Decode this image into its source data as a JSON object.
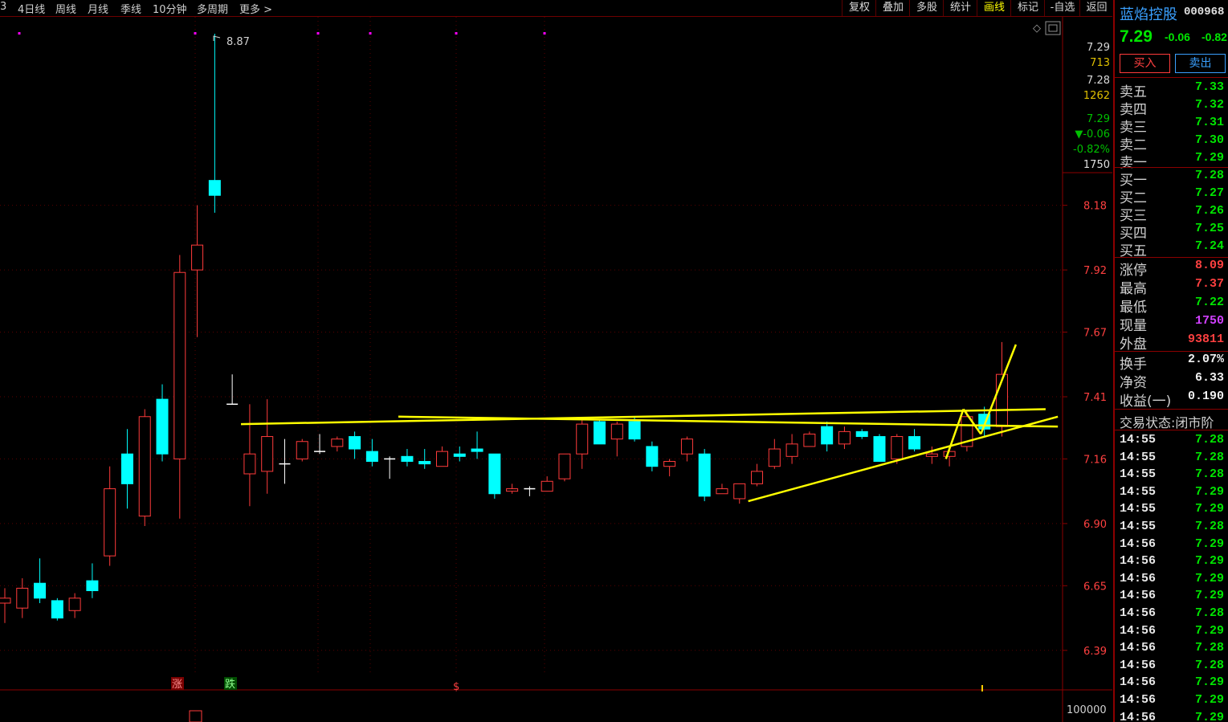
{
  "topbar": {
    "left_tabs": [
      "3",
      "4日线",
      "周线",
      "月线",
      "季线",
      "10分钟",
      "多周期",
      "更多 >"
    ],
    "right_tabs": [
      "复权",
      "叠加",
      "多股",
      "统计",
      "画线",
      "标记",
      "-自选",
      "返回"
    ],
    "active_right_tab": "画线"
  },
  "chart": {
    "peak_label": "8.87",
    "markers": [
      "涨",
      "跌",
      "$"
    ],
    "volume_axis_label": "100000",
    "price_ticks": [
      "8.18",
      "7.92",
      "7.67",
      "7.41",
      "7.16",
      "6.90",
      "6.65",
      "6.39"
    ],
    "info_panel": [
      "7.29",
      "713",
      "7.28",
      "1262",
      "7.29",
      "▼-0.06",
      "-0.82%",
      "1750"
    ],
    "colors": {
      "up": "#ff3b3b",
      "down": "#00ffff",
      "drawing": "#ffff00",
      "grid": "#5a0000"
    }
  },
  "chart_data": {
    "type": "candlestick",
    "ylim": [
      6.25,
      9.0
    ],
    "candles": [
      {
        "o": 6.58,
        "h": 6.64,
        "l": 6.5,
        "c": 6.6
      },
      {
        "o": 6.56,
        "h": 6.68,
        "l": 6.52,
        "c": 6.64
      },
      {
        "o": 6.66,
        "h": 6.76,
        "l": 6.58,
        "c": 6.6
      },
      {
        "o": 6.59,
        "h": 6.6,
        "l": 6.51,
        "c": 6.52
      },
      {
        "o": 6.55,
        "h": 6.62,
        "l": 6.52,
        "c": 6.6
      },
      {
        "o": 6.67,
        "h": 6.74,
        "l": 6.6,
        "c": 6.63
      },
      {
        "o": 6.77,
        "h": 7.13,
        "l": 6.73,
        "c": 7.04
      },
      {
        "o": 7.18,
        "h": 7.28,
        "l": 6.96,
        "c": 7.06
      },
      {
        "o": 6.93,
        "h": 7.36,
        "l": 6.89,
        "c": 7.33
      },
      {
        "o": 7.4,
        "h": 7.46,
        "l": 7.15,
        "c": 7.18
      },
      {
        "o": 7.16,
        "h": 7.98,
        "l": 6.92,
        "c": 7.91
      },
      {
        "o": 7.92,
        "h": 8.18,
        "l": 7.65,
        "c": 8.02
      },
      {
        "o": 8.28,
        "h": 8.87,
        "l": 8.15,
        "c": 8.22
      },
      {
        "o": 7.38,
        "h": 7.5,
        "l": 7.38,
        "c": 7.38
      },
      {
        "o": 7.1,
        "h": 7.38,
        "l": 6.97,
        "c": 7.18
      },
      {
        "o": 7.11,
        "h": 7.4,
        "l": 7.02,
        "c": 7.25
      },
      {
        "o": 7.14,
        "h": 7.24,
        "l": 7.06,
        "c": 7.14
      },
      {
        "o": 7.16,
        "h": 7.24,
        "l": 7.15,
        "c": 7.23
      },
      {
        "o": 7.19,
        "h": 7.26,
        "l": 7.18,
        "c": 7.19
      },
      {
        "o": 7.21,
        "h": 7.25,
        "l": 7.19,
        "c": 7.24
      },
      {
        "o": 7.25,
        "h": 7.27,
        "l": 7.16,
        "c": 7.2
      },
      {
        "o": 7.19,
        "h": 7.24,
        "l": 7.13,
        "c": 7.15
      },
      {
        "o": 7.16,
        "h": 7.17,
        "l": 7.08,
        "c": 7.16
      },
      {
        "o": 7.17,
        "h": 7.2,
        "l": 7.13,
        "c": 7.15
      },
      {
        "o": 7.15,
        "h": 7.2,
        "l": 7.12,
        "c": 7.14
      },
      {
        "o": 7.13,
        "h": 7.21,
        "l": 7.13,
        "c": 7.19
      },
      {
        "o": 7.18,
        "h": 7.21,
        "l": 7.15,
        "c": 7.17
      },
      {
        "o": 7.2,
        "h": 7.27,
        "l": 7.16,
        "c": 7.19
      },
      {
        "o": 7.18,
        "h": 7.18,
        "l": 7.0,
        "c": 7.02
      },
      {
        "o": 7.03,
        "h": 7.06,
        "l": 7.02,
        "c": 7.04
      },
      {
        "o": 7.04,
        "h": 7.05,
        "l": 7.01,
        "c": 7.04
      },
      {
        "o": 7.03,
        "h": 7.09,
        "l": 7.03,
        "c": 7.07
      },
      {
        "o": 7.08,
        "h": 7.18,
        "l": 7.07,
        "c": 7.18
      },
      {
        "o": 7.18,
        "h": 7.32,
        "l": 7.12,
        "c": 7.3
      },
      {
        "o": 7.31,
        "h": 7.32,
        "l": 7.22,
        "c": 7.22
      },
      {
        "o": 7.24,
        "h": 7.31,
        "l": 7.17,
        "c": 7.3
      },
      {
        "o": 7.31,
        "h": 7.33,
        "l": 7.23,
        "c": 7.24
      },
      {
        "o": 7.21,
        "h": 7.23,
        "l": 7.11,
        "c": 7.13
      },
      {
        "o": 7.13,
        "h": 7.16,
        "l": 7.09,
        "c": 7.15
      },
      {
        "o": 7.18,
        "h": 7.25,
        "l": 7.15,
        "c": 7.24
      },
      {
        "o": 7.18,
        "h": 7.2,
        "l": 6.99,
        "c": 7.01
      },
      {
        "o": 7.02,
        "h": 7.06,
        "l": 7.02,
        "c": 7.04
      },
      {
        "o": 7.0,
        "h": 7.06,
        "l": 6.98,
        "c": 7.06
      },
      {
        "o": 7.06,
        "h": 7.14,
        "l": 7.05,
        "c": 7.11
      },
      {
        "o": 7.13,
        "h": 7.24,
        "l": 7.12,
        "c": 7.2
      },
      {
        "o": 7.17,
        "h": 7.26,
        "l": 7.14,
        "c": 7.22
      },
      {
        "o": 7.21,
        "h": 7.27,
        "l": 7.21,
        "c": 7.26
      },
      {
        "o": 7.29,
        "h": 7.31,
        "l": 7.19,
        "c": 7.22
      },
      {
        "o": 7.22,
        "h": 7.29,
        "l": 7.2,
        "c": 7.27
      },
      {
        "o": 7.27,
        "h": 7.28,
        "l": 7.24,
        "c": 7.25
      },
      {
        "o": 7.25,
        "h": 7.26,
        "l": 7.15,
        "c": 7.15
      },
      {
        "o": 7.16,
        "h": 7.26,
        "l": 7.14,
        "c": 7.25
      },
      {
        "o": 7.25,
        "h": 7.28,
        "l": 7.19,
        "c": 7.2
      },
      {
        "o": 7.17,
        "h": 7.21,
        "l": 7.14,
        "c": 7.18
      },
      {
        "o": 7.17,
        "h": 7.2,
        "l": 7.13,
        "c": 7.19
      },
      {
        "o": 7.21,
        "h": 7.35,
        "l": 7.19,
        "c": 7.33
      },
      {
        "o": 7.34,
        "h": 7.37,
        "l": 7.25,
        "c": 7.28
      },
      {
        "o": 7.29,
        "h": 7.63,
        "l": 7.25,
        "c": 7.5
      }
    ],
    "trendlines": [
      {
        "from": [
          13.5,
          7.3
        ],
        "to": [
          59.5,
          7.36
        ]
      },
      {
        "from": [
          22.5,
          7.33
        ],
        "to": [
          60.2,
          7.29
        ]
      },
      {
        "from": [
          42.5,
          6.99
        ],
        "to": [
          60.2,
          7.33
        ]
      },
      {
        "from": [
          53.8,
          7.16
        ],
        "to": [
          54.8,
          7.36
        ]
      },
      {
        "from": [
          54.8,
          7.36
        ],
        "to": [
          55.8,
          7.26
        ]
      },
      {
        "from": [
          55.8,
          7.26
        ],
        "to": [
          57.8,
          7.62
        ]
      }
    ]
  },
  "quote": {
    "stock_name": "蓝焰控股",
    "stock_code": "000968",
    "price": "7.29",
    "change": "-0.06",
    "change_pct": "-0.82",
    "buy_label": "买入",
    "sell_label": "卖出",
    "asks": [
      {
        "label": "卖五",
        "price": "7.33"
      },
      {
        "label": "卖四",
        "price": "7.32"
      },
      {
        "label": "卖三",
        "price": "7.31"
      },
      {
        "label": "卖二",
        "price": "7.30"
      },
      {
        "label": "卖一",
        "price": "7.29"
      }
    ],
    "bids": [
      {
        "label": "买一",
        "price": "7.28"
      },
      {
        "label": "买二",
        "price": "7.27"
      },
      {
        "label": "买三",
        "price": "7.26"
      },
      {
        "label": "买四",
        "price": "7.25"
      },
      {
        "label": "买五",
        "price": "7.24"
      }
    ],
    "stats": [
      {
        "label": "涨停",
        "value": "8.09",
        "color": "#ff4040"
      },
      {
        "label": "最高",
        "value": "7.37",
        "color": "#ff4040"
      },
      {
        "label": "最低",
        "value": "7.22",
        "color": "#00e600"
      },
      {
        "label": "现量",
        "value": "1750",
        "color": "#d040ff"
      },
      {
        "label": "外盘",
        "value": "93811",
        "color": "#ff4040"
      }
    ],
    "stats2": [
      {
        "label": "换手",
        "value": "2.07%"
      },
      {
        "label": "净资",
        "value": "6.33"
      },
      {
        "label": "收益(一)",
        "value": "0.190"
      }
    ],
    "trade_status": "交易状态:闭市阶"
  },
  "ticks": [
    {
      "time": "14:55",
      "price": "7.28",
      "dir": "green"
    },
    {
      "time": "14:55",
      "price": "7.28",
      "dir": "green"
    },
    {
      "time": "14:55",
      "price": "7.28",
      "dir": "green"
    },
    {
      "time": "14:55",
      "price": "7.29",
      "dir": "green"
    },
    {
      "time": "14:55",
      "price": "7.29",
      "dir": "green"
    },
    {
      "time": "14:55",
      "price": "7.28",
      "dir": "green"
    },
    {
      "time": "14:56",
      "price": "7.29",
      "dir": "green"
    },
    {
      "time": "14:56",
      "price": "7.29",
      "dir": "green"
    },
    {
      "time": "14:56",
      "price": "7.29",
      "dir": "green"
    },
    {
      "time": "14:56",
      "price": "7.29",
      "dir": "green"
    },
    {
      "time": "14:56",
      "price": "7.28",
      "dir": "green"
    },
    {
      "time": "14:56",
      "price": "7.29",
      "dir": "green"
    },
    {
      "time": "14:56",
      "price": "7.28",
      "dir": "green"
    },
    {
      "time": "14:56",
      "price": "7.28",
      "dir": "green"
    },
    {
      "time": "14:56",
      "price": "7.29",
      "dir": "green"
    },
    {
      "time": "14:56",
      "price": "7.29",
      "dir": "green"
    },
    {
      "time": "14:56",
      "price": "7.29",
      "dir": "green"
    }
  ]
}
